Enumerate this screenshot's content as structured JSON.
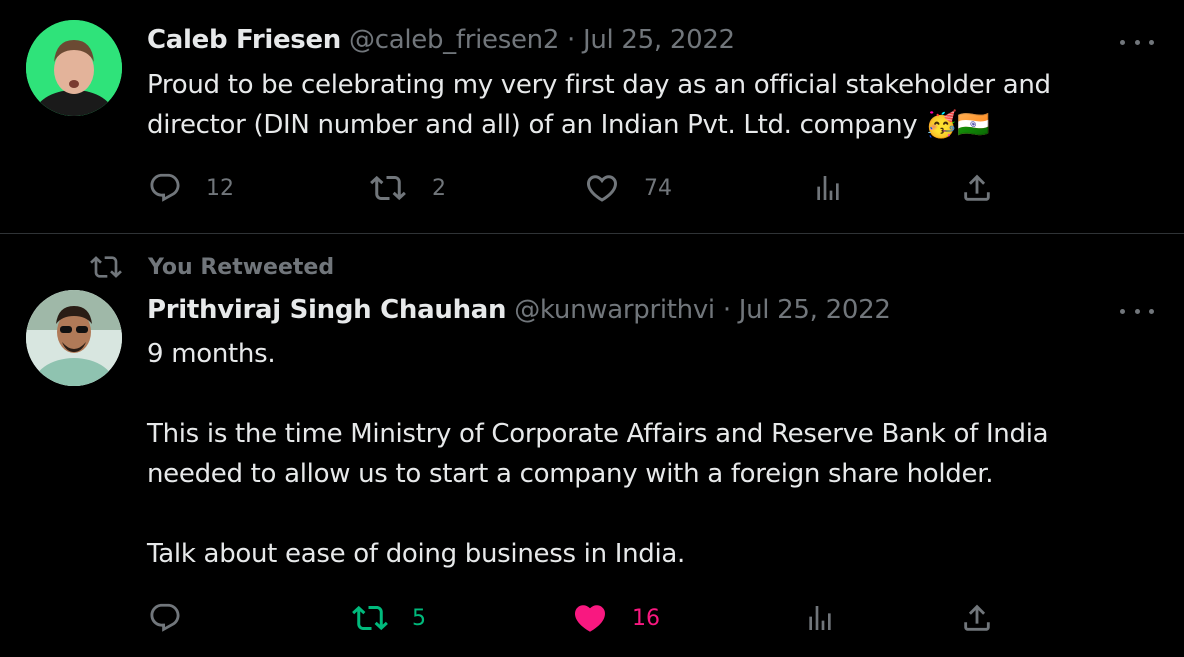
{
  "tweets": [
    {
      "author_name": "Caleb Friesen",
      "handle": "@caleb_friesen2",
      "separator": "·",
      "date": "Jul 25, 2022",
      "text_lines": [
        "Proud to be celebrating my very first day as an official stakeholder and",
        "director (DIN number and all) of an Indian Pvt. Ltd. company 🥳🇮🇳"
      ],
      "stats": {
        "replies": "12",
        "retweets": "2",
        "likes": "74"
      },
      "retweeted": false,
      "liked": false
    },
    {
      "social_context": "You Retweeted",
      "author_name": "Prithviraj Singh Chauhan",
      "handle": "@kunwarprithvi",
      "separator": "·",
      "date": "Jul 25, 2022",
      "paragraphs": [
        "9 months.",
        "This is the time Ministry of Corporate Affairs and Reserve Bank of India",
        "needed to allow us to start a company with a foreign share holder.",
        "Talk about ease of doing business in India."
      ],
      "stats": {
        "replies": "",
        "retweets": "5",
        "likes": "16"
      },
      "retweeted": true,
      "liked": true
    }
  ],
  "icons": {
    "reply": "reply-icon",
    "retweet": "retweet-icon",
    "like": "heart-icon",
    "views": "analytics-icon",
    "share": "share-icon",
    "more": "more-icon"
  },
  "colors": {
    "background": "#000000",
    "text": "#e7e9ea",
    "muted": "#71767b",
    "retweet_active": "#00ba7c",
    "like_active": "#f91880",
    "divider": "#2f3336"
  }
}
